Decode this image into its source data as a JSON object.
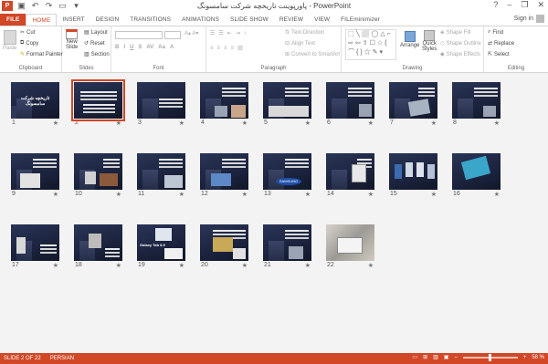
{
  "window": {
    "title": "پاورپوینت تاریخچه شرکت سامسونگ - PowerPoint",
    "app_badge": "P",
    "controls": [
      "?",
      "–",
      "❐",
      "✕"
    ]
  },
  "qat": [
    "save-icon",
    "undo-icon",
    "redo-icon",
    "start-icon",
    "customize-icon"
  ],
  "tabs": [
    "FILE",
    "HOME",
    "INSERT",
    "DESIGN",
    "TRANSITIONS",
    "ANIMATIONS",
    "SLIDE SHOW",
    "REVIEW",
    "VIEW",
    "FILEminimizer"
  ],
  "active_tab": "HOME",
  "signin": "Sign in",
  "ribbon": {
    "clipboard": {
      "paste": "Paste",
      "cut": "Cut",
      "copy": "Copy",
      "format_painter": "Format Painter",
      "label": "Clipboard"
    },
    "slides": {
      "new_slide": "New",
      "new_slide2": "Slide",
      "layout": "Layout",
      "reset": "Reset",
      "section": "Section",
      "label": "Slides"
    },
    "font": {
      "label": "Font"
    },
    "paragraph": {
      "text_direction": "Text Direction",
      "align_text": "Align Text",
      "convert": "Convert to SmartArt",
      "label": "Paragraph"
    },
    "drawing": {
      "arrange": "Arrange",
      "quick_styles": "Quick",
      "quick_styles2": "Styles",
      "shape_fill": "Shape Fill",
      "shape_outline": "Shape Outline",
      "shape_effects": "Shape Effects",
      "label": "Drawing"
    },
    "editing": {
      "find": "Find",
      "replace": "Replace",
      "select": "Select",
      "label": "Editing"
    }
  },
  "slides": [
    {
      "num": "1",
      "star": "★"
    },
    {
      "num": "2",
      "star": "★"
    },
    {
      "num": "3",
      "star": "★"
    },
    {
      "num": "4",
      "star": "★"
    },
    {
      "num": "5",
      "star": "★"
    },
    {
      "num": "6",
      "star": "★"
    },
    {
      "num": "7",
      "star": "★"
    },
    {
      "num": "8",
      "star": "★"
    },
    {
      "num": "9",
      "star": "★"
    },
    {
      "num": "10",
      "star": "★"
    },
    {
      "num": "11",
      "star": "★"
    },
    {
      "num": "12",
      "star": "★"
    },
    {
      "num": "13",
      "star": "★"
    },
    {
      "num": "14",
      "star": "★"
    },
    {
      "num": "15",
      "star": "★"
    },
    {
      "num": "16",
      "star": "★"
    },
    {
      "num": "17",
      "star": "★"
    },
    {
      "num": "18",
      "star": "★"
    },
    {
      "num": "19",
      "star": "★"
    },
    {
      "num": "20",
      "star": "★"
    },
    {
      "num": "21",
      "star": "★"
    },
    {
      "num": "22",
      "star": "★"
    }
  ],
  "selected_slide": 2,
  "slide_text": {
    "title_slide": "تاریخچه شرکت سامسونگ",
    "samsung_logo": "SAMSUNG",
    "galaxy_tab": "Galaxy Tab 8.9"
  },
  "status": {
    "slide_of": "SLIDE 2 OF 22",
    "language": "PERSIAN",
    "zoom": "58 %"
  },
  "colors": {
    "accent": "#d24726"
  }
}
